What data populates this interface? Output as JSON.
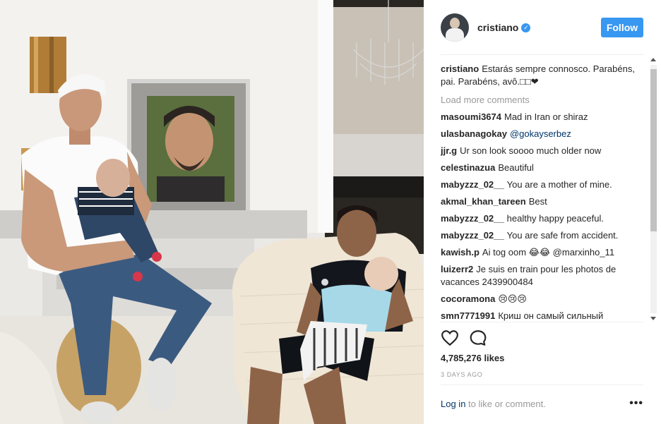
{
  "post": {
    "username": "cristiano",
    "verified_mark": "✓",
    "follow_label": "Follow",
    "caption_user": "cristiano",
    "caption_text": "Estarás sempre connosco. Parabéns, pai. Parabéns, avô.□□❤",
    "load_more": "Load more comments",
    "comments": [
      {
        "user": "masoumi3674",
        "text": "Mad in Iran or shiraz"
      },
      {
        "user": "ulasbanagokay",
        "text": "@gokayserbez"
      },
      {
        "user": "jjr.g",
        "text": "Ur son look soooo much older now"
      },
      {
        "user": "celestinazua",
        "text": "Beautiful"
      },
      {
        "user": "mabyzzz_02__",
        "text": "You are a mother of mine."
      },
      {
        "user": "akmal_khan_tareen",
        "text": "Best"
      },
      {
        "user": "mabyzzz_02__",
        "text": "healthy happy peaceful."
      },
      {
        "user": "mabyzzz_02__",
        "text": "You are safe from accident."
      },
      {
        "user": "kawish.p",
        "text": "Ai tog oom 😂😂 @marxinho_11"
      },
      {
        "user": "luizerr2",
        "text": "Je suis en train pour les photos de vacances 2439900484"
      },
      {
        "user": "cocoramona",
        "text": "😢😢😢"
      },
      {
        "user": "smn7771991",
        "text": "Криш он самый сильный"
      }
    ],
    "likes": "4,785,276 likes",
    "timestamp": "3 DAYS AGO",
    "footer_login": "Log in",
    "footer_rest": " to like or comment.",
    "more_dots": "•••"
  },
  "icons": {
    "like": "heart-outline-icon",
    "comment": "speech-bubble-icon",
    "more": "more-dots-icon",
    "verified": "verified-badge-icon"
  },
  "colors": {
    "accent": "#3897f0",
    "link": "#003569",
    "muted": "#999999",
    "text": "#262626"
  }
}
